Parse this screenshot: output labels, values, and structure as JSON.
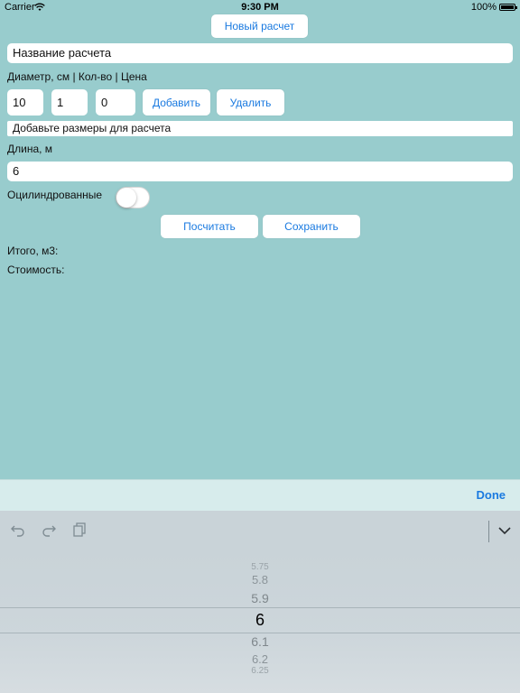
{
  "status_bar": {
    "carrier": "Carrier",
    "time": "9:30 PM",
    "battery": "100%"
  },
  "top": {
    "new_calc_button": "Новый расчет"
  },
  "form": {
    "name_placeholder": "Название расчета",
    "columns_label": "Диаметр, см | Кол-во | Цена",
    "diameter": "10",
    "quantity": "1",
    "price": "0",
    "add_button": "Добавить",
    "delete_button": "Удалить",
    "sizes_hint": "Добавьте размеры для расчета",
    "length_label": "Длина, м",
    "length_value": "6",
    "rounded_label": "Оцилиндрованные",
    "rounded_on": false,
    "calc_button": "Посчитать",
    "save_button": "Сохранить",
    "total_label": "Итого, м3:",
    "cost_label": "Стоимость:"
  },
  "keyboard": {
    "done": "Done",
    "icons": [
      "undo-icon",
      "redo-icon",
      "paste-icon",
      "chevron-down-icon"
    ]
  },
  "picker": {
    "values": [
      "5.75",
      "5.8",
      "5.9",
      "6",
      "6.1",
      "6.2",
      "6.25"
    ],
    "selected": "6"
  },
  "colors": {
    "background": "#98cccd",
    "accent": "#1a7ae0"
  }
}
